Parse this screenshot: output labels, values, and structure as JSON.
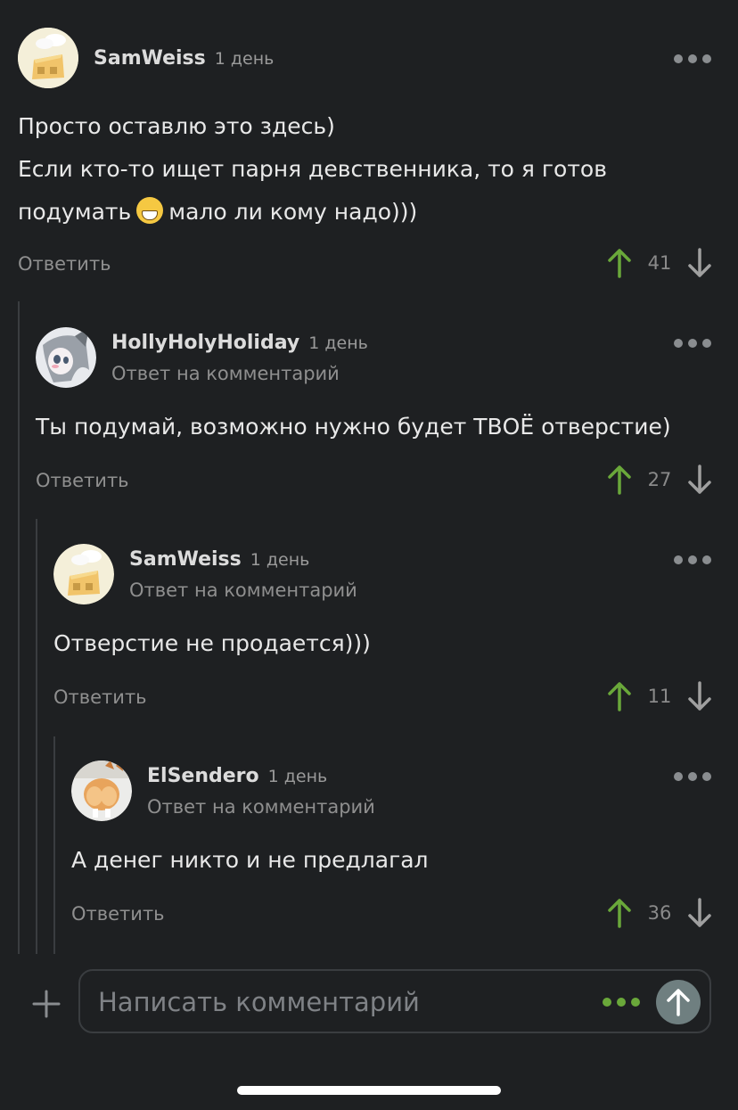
{
  "comments": [
    {
      "author": "SamWeiss",
      "time": "1 день",
      "subtitle": "",
      "lines": [
        "Просто оставлю это здесь)",
        "Если кто-то ищет парня девственника, то я готов"
      ],
      "line3_before": "подумать",
      "line3_emoji": "grinning-face-emoji",
      "line3_after": "мало ли кому надо)))",
      "reply": "Ответить",
      "votes": "41"
    },
    {
      "author": "HollyHolyHoliday",
      "time": "1 день",
      "subtitle": "Ответ на комментарий",
      "text": "Ты подумай, возможно нужно будет ТВОЁ отверстие)",
      "reply": "Ответить",
      "votes": "27"
    },
    {
      "author": "SamWeiss",
      "time": "1 день",
      "subtitle": "Ответ на комментарий",
      "text": "Отверстие не продается)))",
      "reply": "Ответить",
      "votes": "11"
    },
    {
      "author": "ElSendero",
      "time": "1 день",
      "subtitle": "Ответ на комментарий",
      "text": "А денег никто и не предлагал",
      "reply": "Ответить",
      "votes": "36"
    }
  ],
  "composer": {
    "placeholder": "Написать комментарий",
    "send_icon": "arrow-up-icon",
    "add_icon": "plus-icon"
  },
  "colors": {
    "background": "#1e2022",
    "upvote": "#6aa83a",
    "downvote": "#9a9a9a"
  }
}
